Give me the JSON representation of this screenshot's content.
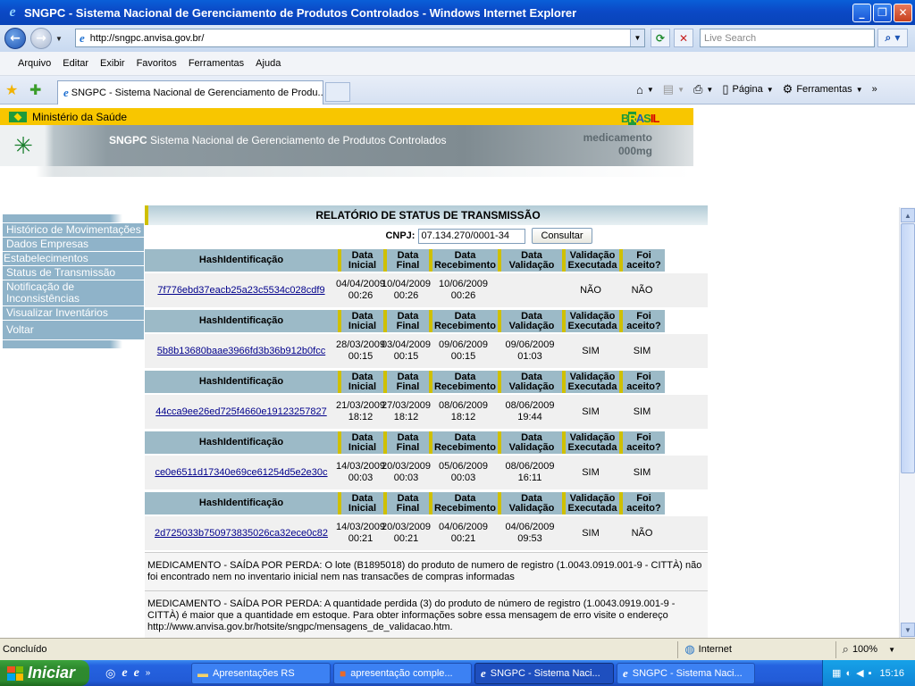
{
  "window": {
    "title": "SNGPC - Sistema Nacional de Gerenciamento de Produtos Controlados - Windows Internet Explorer"
  },
  "address": {
    "url": "http://sngpc.anvisa.gov.br/",
    "search_placeholder": "Live Search"
  },
  "menu": [
    "Arquivo",
    "Editar",
    "Exibir",
    "Favoritos",
    "Ferramentas",
    "Ajuda"
  ],
  "tab": {
    "label": "SNGPC - Sistema Nacional de Gerenciamento de Produ..."
  },
  "toolbar": {
    "pagina": "Página",
    "ferramentas": "Ferramentas"
  },
  "site": {
    "ministry": "Ministério da Saúde",
    "brasil": "BRASIL",
    "sngpc": "SNGPC",
    "system_name": "Sistema Nacional de Gerenciamento de Produtos Controlados",
    "med_line1": "medicamento",
    "med_line2": "000mg"
  },
  "sidebar": [
    {
      "label": "Histórico de Movimentações"
    },
    {
      "label": "Dados Empresas"
    },
    {
      "label": "Estabelecimentos"
    },
    {
      "label": "Status de Transmissão"
    },
    {
      "label": "Notificação de Inconsistências"
    },
    {
      "label": "Visualizar Inventários"
    },
    {
      "label": "Voltar"
    }
  ],
  "report": {
    "title": "RELATÓRIO DE STATUS DE TRANSMISSÃO",
    "cnpj_label": "CNPJ:",
    "cnpj_value": "07.134.270/0001-34",
    "consult_button": "Consultar",
    "columns": [
      "HashIdentificação",
      "Data Inicial",
      "Data Final",
      "Data Recebimento",
      "Data Validação",
      "Validação Executada",
      "Foi aceito?"
    ],
    "rows": [
      {
        "hash": "7f776ebd37eacb25a23c5534c028cdf9",
        "ini_d": "04/04/2009",
        "ini_t": "00:26",
        "fin_d": "10/04/2009",
        "fin_t": "00:26",
        "rec_d": "10/06/2009",
        "rec_t": "00:26",
        "val_d": "",
        "val_t": "",
        "exec": "NÃO",
        "aceito": "NÃO"
      },
      {
        "hash": "5b8b13680baae3966fd3b36b912b0fcc",
        "ini_d": "28/03/2009",
        "ini_t": "00:15",
        "fin_d": "03/04/2009",
        "fin_t": "00:15",
        "rec_d": "09/06/2009",
        "rec_t": "00:15",
        "val_d": "09/06/2009",
        "val_t": "01:03",
        "exec": "SIM",
        "aceito": "SIM"
      },
      {
        "hash": "44cca9ee26ed725f4660e19123257827",
        "ini_d": "21/03/2009",
        "ini_t": "18:12",
        "fin_d": "27/03/2009",
        "fin_t": "18:12",
        "rec_d": "08/06/2009",
        "rec_t": "18:12",
        "val_d": "08/06/2009",
        "val_t": "19:44",
        "exec": "SIM",
        "aceito": "SIM"
      },
      {
        "hash": "ce0e6511d17340e69ce61254d5e2e30c",
        "ini_d": "14/03/2009",
        "ini_t": "00:03",
        "fin_d": "20/03/2009",
        "fin_t": "00:03",
        "rec_d": "05/06/2009",
        "rec_t": "00:03",
        "val_d": "08/06/2009",
        "val_t": "16:11",
        "exec": "SIM",
        "aceito": "SIM"
      },
      {
        "hash": "2d725033b750973835026ca32ece0c82",
        "ini_d": "14/03/2009",
        "ini_t": "00:21",
        "fin_d": "20/03/2009",
        "fin_t": "00:21",
        "rec_d": "04/06/2009",
        "rec_t": "00:21",
        "val_d": "04/06/2009",
        "val_t": "09:53",
        "exec": "SIM",
        "aceito": "NÃO"
      }
    ],
    "notes": [
      "MEDICAMENTO - SAÍDA POR PERDA: O lote (B1895018) do produto de numero de registro (1.0043.0919.001-9 - CITTÀ) não foi encontrado nem no inventario inicial nem nas transacões de compras informadas",
      "MEDICAMENTO - SAÍDA POR PERDA: A quantidade perdida (3) do produto de número de registro (1.0043.0919.001-9 - CITTÀ) é maior que a quantidade em estoque. Para obter informações sobre essa mensagem de erro visite o endereço http://www.anvisa.gov.br/hotsite/sngpc/mensagens_de_validacao.htm."
    ]
  },
  "status": {
    "left": "Concluído",
    "zone": "Internet",
    "zoom": "100%"
  },
  "taskbar": {
    "start": "Iniciar",
    "items": [
      {
        "label": "Apresentações RS",
        "icon": "folder-icon"
      },
      {
        "label": "apresentação comple...",
        "icon": "powerpoint-icon"
      },
      {
        "label": "SNGPC - Sistema Naci...",
        "icon": "ie-icon"
      },
      {
        "label": "SNGPC - Sistema Naci...",
        "icon": "ie-icon"
      }
    ],
    "clock": "15:16"
  }
}
